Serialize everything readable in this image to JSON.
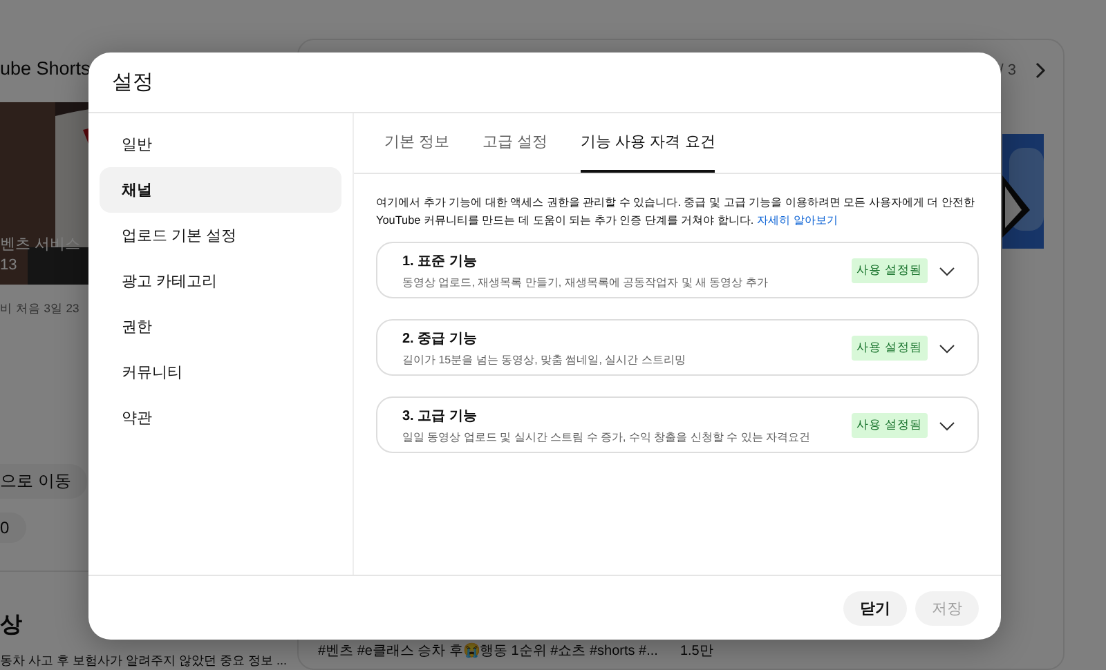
{
  "background": {
    "left_card": {
      "title": "ube Shorts",
      "picture_caption": "벤츠 서비스",
      "picture_count": "13",
      "meta": "비 처음 3일 23"
    },
    "chips": [
      "으로 이동",
      "0"
    ],
    "section_title": "상",
    "video_title": "동차 사고 후 보험사가 알려주지 않았던 중요 정보 ...",
    "right_card": {
      "pager": "/ 3",
      "caption": "#벤츠 #e클래스 승차 후😭행동 1순위 #쇼츠 #shorts #...",
      "views": "1.5만"
    }
  },
  "dialog": {
    "title": "설정",
    "nav": [
      {
        "label": "일반",
        "selected": false
      },
      {
        "label": "채널",
        "selected": true
      },
      {
        "label": "업로드 기본 설정",
        "selected": false
      },
      {
        "label": "광고 카테고리",
        "selected": false
      },
      {
        "label": "권한",
        "selected": false
      },
      {
        "label": "커뮤니티",
        "selected": false
      },
      {
        "label": "약관",
        "selected": false
      }
    ],
    "tabs": [
      {
        "label": "기본 정보",
        "selected": false
      },
      {
        "label": "고급 설정",
        "selected": false
      },
      {
        "label": "기능 사용 자격 요건",
        "selected": true
      }
    ],
    "description": "여기에서 추가 기능에 대한 액세스 권한을 관리할 수 있습니다. 중급 및 고급 기능을 이용하려면 모든 사용자에게 더 안전한 YouTube 커뮤니티를 만드는 데 도움이 되는 추가 인증 단계를 거쳐야 합니다.",
    "link": "자세히 알아보기",
    "features": [
      {
        "title": "1. 표준 기능",
        "description": "동영상 업로드, 재생목록 만들기, 재생목록에 공동작업자 및 새 동영상 추가",
        "status": "사용 설정됨",
        "expanded": false
      },
      {
        "title": "2. 중급 기능",
        "description": "길이가 15분을 넘는 동영상, 맞춤 썸네일, 실시간 스트리밍",
        "status": "사용 설정됨",
        "expanded": false
      },
      {
        "title": "3. 고급 기능",
        "description": "일일 동영상 업로드 및 실시간 스트림 수 증가, 수익 창출을 신청할 수 있는 자격요건",
        "status": "사용 설정됨",
        "expanded": false
      }
    ],
    "buttons": [
      {
        "label": "닫기",
        "disabled": false
      },
      {
        "label": "저장",
        "disabled": true
      }
    ]
  }
}
